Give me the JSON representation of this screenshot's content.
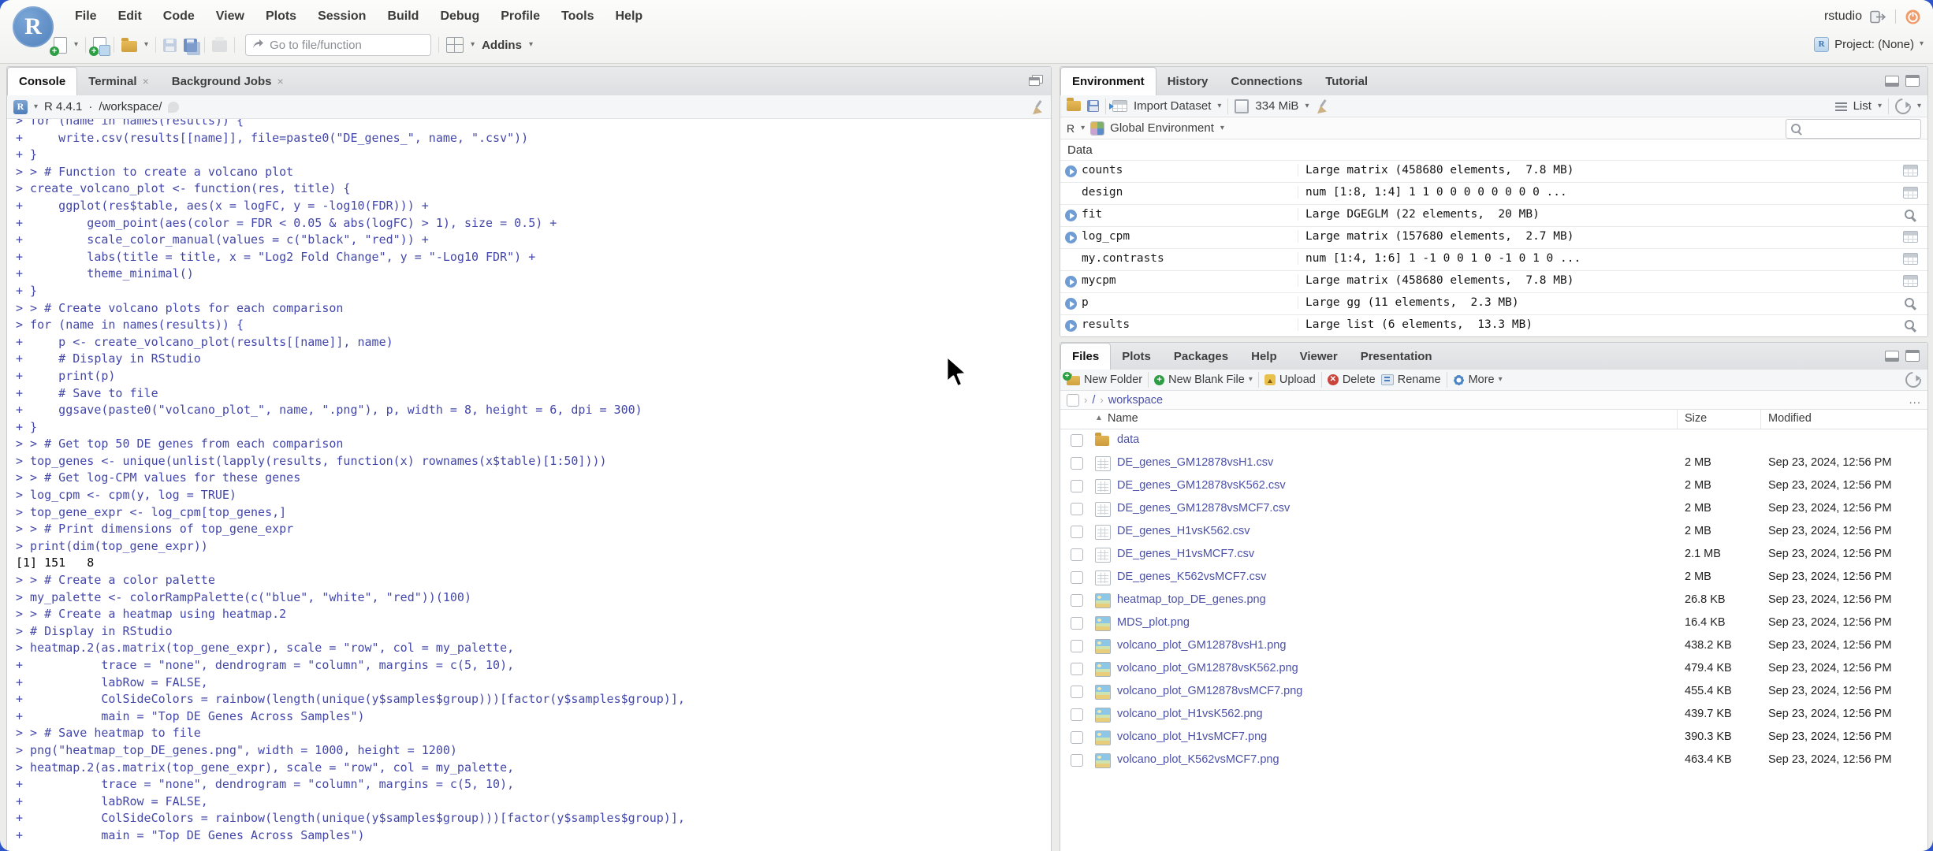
{
  "ui": {
    "r_glyph": "R",
    "close_glyph": "×",
    "caret_glyph": "▾",
    "chevron_glyph": "›",
    "sort_glyph": "▲",
    "ellipsis_glyph": "..."
  },
  "menu_bar": {
    "items": [
      "File",
      "Edit",
      "Code",
      "View",
      "Plots",
      "Session",
      "Build",
      "Debug",
      "Profile",
      "Tools",
      "Help"
    ]
  },
  "toolbar": {
    "goto_placeholder": "Go to file/function",
    "addins_label": "Addins"
  },
  "session_bar": {
    "username": "rstudio",
    "project_label": "Project: (None)"
  },
  "console_panel": {
    "tabs": [
      {
        "label": "Console",
        "state": "active",
        "closable": "no"
      },
      {
        "label": "Terminal",
        "state": "idle",
        "closable": "yes"
      },
      {
        "label": "Background Jobs",
        "state": "idle",
        "closable": "yes"
      }
    ],
    "r_version": "R 4.4.1",
    "separator": "·",
    "working_dir": "/workspace/",
    "lines": [
      {
        "kind": "input",
        "text": "> for (name in names(results)) {"
      },
      {
        "kind": "input",
        "text": "+     write.csv(results[[name]], file=paste0(\"DE_genes_\", name, \".csv\"))"
      },
      {
        "kind": "input",
        "text": "+ }"
      },
      {
        "kind": "input",
        "text": "> > # Function to create a volcano plot"
      },
      {
        "kind": "input",
        "text": "> create_volcano_plot <- function(res, title) {"
      },
      {
        "kind": "input",
        "text": "+     ggplot(res$table, aes(x = logFC, y = -log10(FDR))) +"
      },
      {
        "kind": "input",
        "text": "+         geom_point(aes(color = FDR < 0.05 & abs(logFC) > 1), size = 0.5) +"
      },
      {
        "kind": "input",
        "text": "+         scale_color_manual(values = c(\"black\", \"red\")) +"
      },
      {
        "kind": "input",
        "text": "+         labs(title = title, x = \"Log2 Fold Change\", y = \"-Log10 FDR\") +"
      },
      {
        "kind": "input",
        "text": "+         theme_minimal()"
      },
      {
        "kind": "input",
        "text": "+ }"
      },
      {
        "kind": "input",
        "text": "> > # Create volcano plots for each comparison"
      },
      {
        "kind": "input",
        "text": "> for (name in names(results)) {"
      },
      {
        "kind": "input",
        "text": "+     p <- create_volcano_plot(results[[name]], name)"
      },
      {
        "kind": "input",
        "text": "+     # Display in RStudio"
      },
      {
        "kind": "input",
        "text": "+     print(p)"
      },
      {
        "kind": "input",
        "text": "+     # Save to file"
      },
      {
        "kind": "input",
        "text": "+     ggsave(paste0(\"volcano_plot_\", name, \".png\"), p, width = 8, height = 6, dpi = 300)"
      },
      {
        "kind": "input",
        "text": "+ }"
      },
      {
        "kind": "input",
        "text": "> > # Get top 50 DE genes from each comparison"
      },
      {
        "kind": "input",
        "text": "> top_genes <- unique(unlist(lapply(results, function(x) rownames(x$table)[1:50])))"
      },
      {
        "kind": "input",
        "text": "> > # Get log-CPM values for these genes"
      },
      {
        "kind": "input",
        "text": "> log_cpm <- cpm(y, log = TRUE)"
      },
      {
        "kind": "input",
        "text": "> top_gene_expr <- log_cpm[top_genes,]"
      },
      {
        "kind": "input",
        "text": "> > # Print dimensions of top_gene_expr"
      },
      {
        "kind": "input",
        "text": "> print(dim(top_gene_expr))"
      },
      {
        "kind": "output",
        "text": "[1] 151   8"
      },
      {
        "kind": "input",
        "text": "> > # Create a color palette"
      },
      {
        "kind": "input",
        "text": "> my_palette <- colorRampPalette(c(\"blue\", \"white\", \"red\"))(100)"
      },
      {
        "kind": "input",
        "text": "> > # Create a heatmap using heatmap.2"
      },
      {
        "kind": "input",
        "text": "> # Display in RStudio"
      },
      {
        "kind": "input",
        "text": "> heatmap.2(as.matrix(top_gene_expr), scale = \"row\", col = my_palette,"
      },
      {
        "kind": "input",
        "text": "+           trace = \"none\", dendrogram = \"column\", margins = c(5, 10),"
      },
      {
        "kind": "input",
        "text": "+           labRow = FALSE,"
      },
      {
        "kind": "input",
        "text": "+           ColSideColors = rainbow(length(unique(y$samples$group)))[factor(y$samples$group)],"
      },
      {
        "kind": "input",
        "text": "+           main = \"Top DE Genes Across Samples\")"
      },
      {
        "kind": "input",
        "text": "> > # Save heatmap to file"
      },
      {
        "kind": "input",
        "text": "> png(\"heatmap_top_DE_genes.png\", width = 1000, height = 1200)"
      },
      {
        "kind": "input",
        "text": "> heatmap.2(as.matrix(top_gene_expr), scale = \"row\", col = my_palette,"
      },
      {
        "kind": "input",
        "text": "+           trace = \"none\", dendrogram = \"column\", margins = c(5, 10),"
      },
      {
        "kind": "input",
        "text": "+           labRow = FALSE,"
      },
      {
        "kind": "input",
        "text": "+           ColSideColors = rainbow(length(unique(y$samples$group)))[factor(y$samples$group)],"
      },
      {
        "kind": "input",
        "text": "+           main = \"Top DE Genes Across Samples\")"
      }
    ]
  },
  "environment_panel": {
    "tabs": [
      {
        "label": "Environment",
        "state": "active"
      },
      {
        "label": "History",
        "state": "idle"
      },
      {
        "label": "Connections",
        "state": "idle"
      },
      {
        "label": "Tutorial",
        "state": "idle"
      }
    ],
    "toolbar": {
      "import_label": "Import Dataset",
      "memory_label": "334 MiB",
      "list_label": "List"
    },
    "scope_bar": {
      "language": "R",
      "scope": "Global Environment"
    },
    "section_label": "Data",
    "objects": [
      {
        "name": "counts",
        "value": "Large matrix (458680 elements,  7.8 MB)",
        "icon": "table",
        "expand": "expandable"
      },
      {
        "name": "design",
        "value": "num [1:8, 1:4] 1 1 0 0 0 0 0 0 0 0 ...",
        "icon": "table",
        "expand": "plain"
      },
      {
        "name": "fit",
        "value": "Large DGEGLM (22 elements,  20 MB)",
        "icon": "magnifier",
        "expand": "expandable"
      },
      {
        "name": "log_cpm",
        "value": "Large matrix (157680 elements,  2.7 MB)",
        "icon": "table",
        "expand": "expandable"
      },
      {
        "name": "my.contrasts",
        "value": "num [1:4, 1:6] 1 -1 0 0 1 0 -1 0 1 0 ...",
        "icon": "table",
        "expand": "plain"
      },
      {
        "name": "mycpm",
        "value": "Large matrix (458680 elements,  7.8 MB)",
        "icon": "table",
        "expand": "expandable"
      },
      {
        "name": "p",
        "value": "Large gg (11 elements,  2.3 MB)",
        "icon": "magnifier",
        "expand": "expandable"
      },
      {
        "name": "results",
        "value": "Large list (6 elements,  13.3 MB)",
        "icon": "magnifier",
        "expand": "expandable"
      }
    ]
  },
  "files_panel": {
    "tabs": [
      {
        "label": "Files",
        "state": "active"
      },
      {
        "label": "Plots",
        "state": "idle"
      },
      {
        "label": "Packages",
        "state": "idle"
      },
      {
        "label": "Help",
        "state": "idle"
      },
      {
        "label": "Viewer",
        "state": "idle"
      },
      {
        "label": "Presentation",
        "state": "idle"
      }
    ],
    "toolbar": {
      "new_folder": "New Folder",
      "new_blank_file": "New Blank File",
      "upload": "Upload",
      "delete": "Delete",
      "rename": "Rename",
      "more": "More"
    },
    "breadcrumb": {
      "root": "/",
      "path": "workspace"
    },
    "columns": {
      "name": "Name",
      "size": "Size",
      "modified": "Modified"
    },
    "rows": [
      {
        "type": "folder",
        "name": "data",
        "size": "",
        "modified": ""
      },
      {
        "type": "csv",
        "name": "DE_genes_GM12878vsH1.csv",
        "size": "2 MB",
        "modified": "Sep 23, 2024, 12:56 PM"
      },
      {
        "type": "csv",
        "name": "DE_genes_GM12878vsK562.csv",
        "size": "2 MB",
        "modified": "Sep 23, 2024, 12:56 PM"
      },
      {
        "type": "csv",
        "name": "DE_genes_GM12878vsMCF7.csv",
        "size": "2 MB",
        "modified": "Sep 23, 2024, 12:56 PM"
      },
      {
        "type": "csv",
        "name": "DE_genes_H1vsK562.csv",
        "size": "2 MB",
        "modified": "Sep 23, 2024, 12:56 PM"
      },
      {
        "type": "csv",
        "name": "DE_genes_H1vsMCF7.csv",
        "size": "2.1 MB",
        "modified": "Sep 23, 2024, 12:56 PM"
      },
      {
        "type": "csv",
        "name": "DE_genes_K562vsMCF7.csv",
        "size": "2 MB",
        "modified": "Sep 23, 2024, 12:56 PM"
      },
      {
        "type": "image",
        "name": "heatmap_top_DE_genes.png",
        "size": "26.8 KB",
        "modified": "Sep 23, 2024, 12:56 PM"
      },
      {
        "type": "image",
        "name": "MDS_plot.png",
        "size": "16.4 KB",
        "modified": "Sep 23, 2024, 12:56 PM"
      },
      {
        "type": "image",
        "name": "volcano_plot_GM12878vsH1.png",
        "size": "438.2 KB",
        "modified": "Sep 23, 2024, 12:56 PM"
      },
      {
        "type": "image",
        "name": "volcano_plot_GM12878vsK562.png",
        "size": "479.4 KB",
        "modified": "Sep 23, 2024, 12:56 PM"
      },
      {
        "type": "image",
        "name": "volcano_plot_GM12878vsMCF7.png",
        "size": "455.4 KB",
        "modified": "Sep 23, 2024, 12:56 PM"
      },
      {
        "type": "image",
        "name": "volcano_plot_H1vsK562.png",
        "size": "439.7 KB",
        "modified": "Sep 23, 2024, 12:56 PM"
      },
      {
        "type": "image",
        "name": "volcano_plot_H1vsMCF7.png",
        "size": "390.3 KB",
        "modified": "Sep 23, 2024, 12:56 PM"
      },
      {
        "type": "image",
        "name": "volcano_plot_K562vsMCF7.png",
        "size": "463.4 KB",
        "modified": "Sep 23, 2024, 12:56 PM"
      }
    ]
  }
}
